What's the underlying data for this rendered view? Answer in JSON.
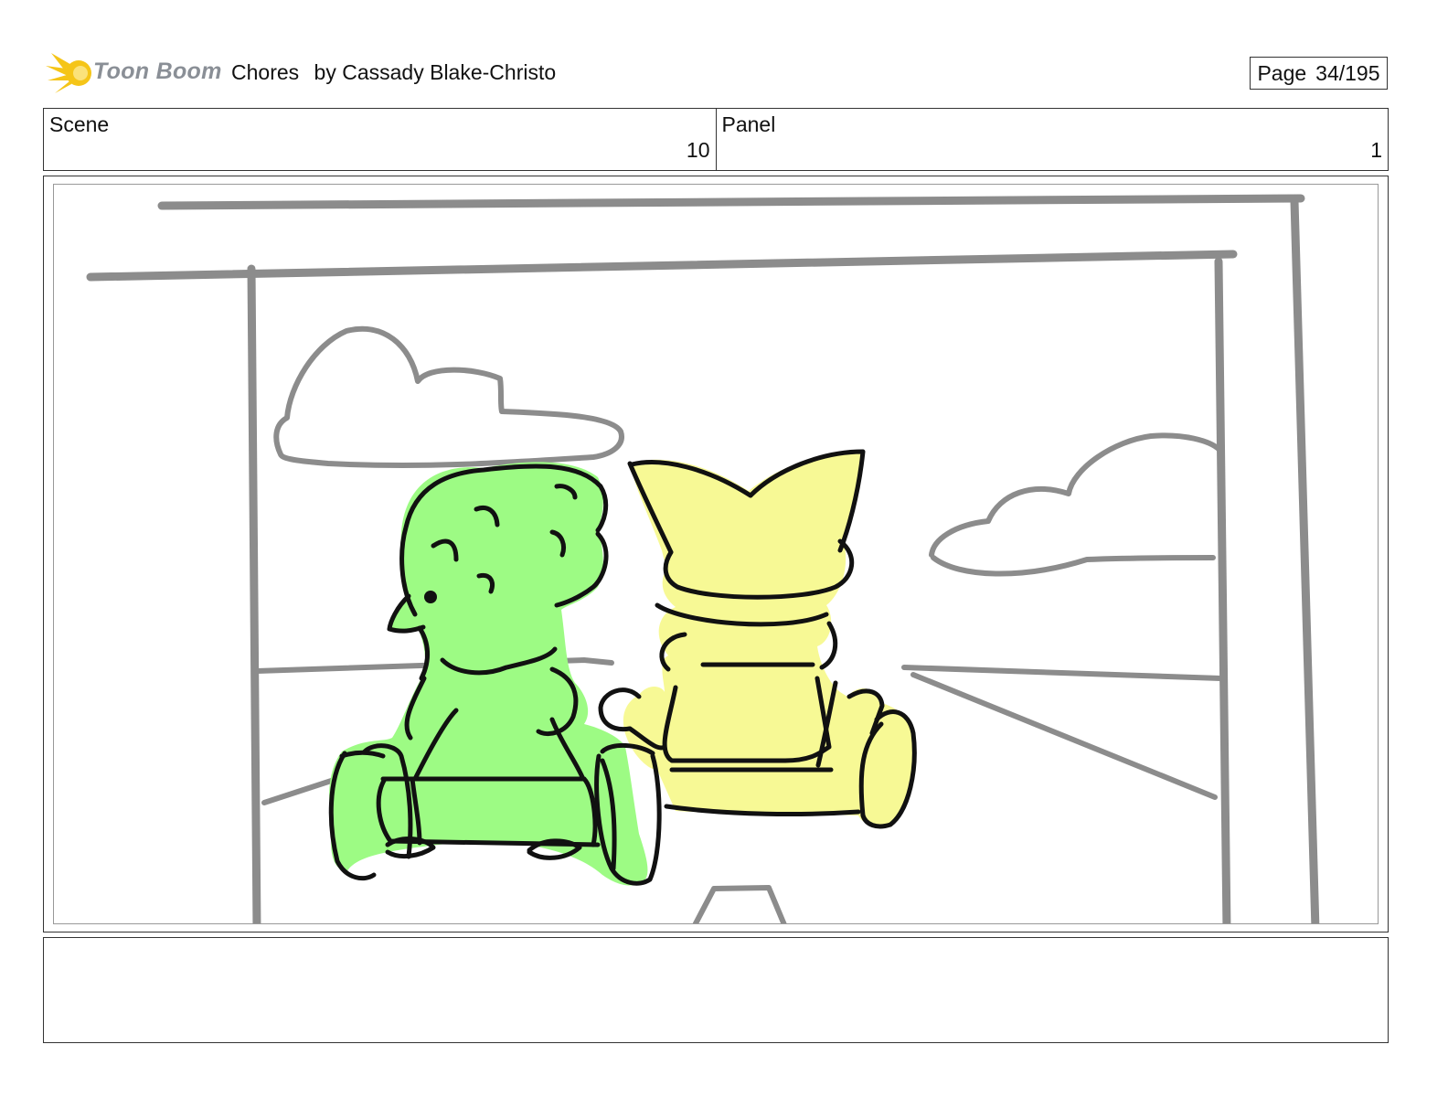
{
  "header": {
    "logo_text": "Toon Boom",
    "title": "Chores",
    "author": "by Cassady Blake-Christo",
    "page_label": "Page",
    "page_value": "34/195"
  },
  "info": {
    "scene_label": "Scene",
    "scene_value": "10",
    "panel_label": "Panel",
    "panel_value": "1"
  },
  "notes": {
    "text": ""
  },
  "colors": {
    "green_character": "#9dfb84",
    "yellow_character": "#f7f995",
    "sketch_gray": "#8c8c8c",
    "ink": "#111111",
    "logo_flame": "#f5c518"
  },
  "drawing": {
    "characters": [
      "green-character-back-view",
      "yellow-character-back-view"
    ],
    "elements": [
      "clouds",
      "road",
      "background-frame-lines",
      "go-karts"
    ]
  }
}
